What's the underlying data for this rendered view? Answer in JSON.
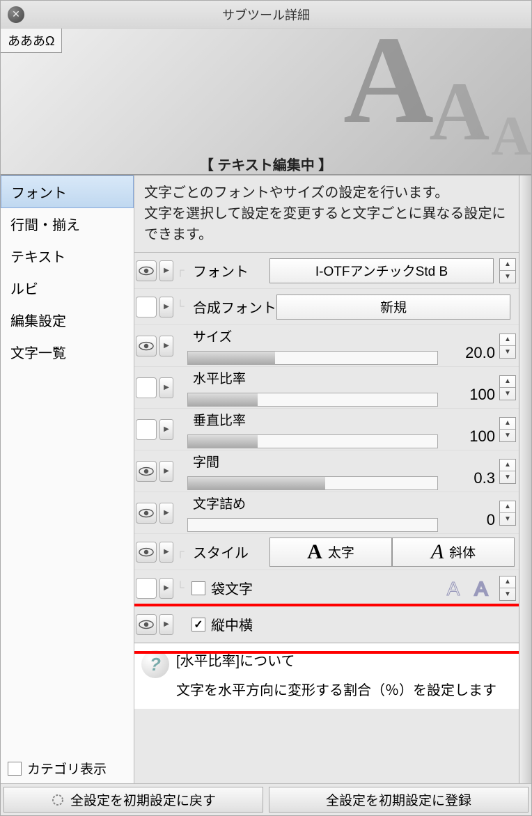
{
  "title": "サブツール詳細",
  "preview_tab": "あああΩ",
  "editing_text": "【 テキスト編集中 】",
  "sidebar": {
    "items": [
      {
        "label": "フォント"
      },
      {
        "label": "行間・揃え"
      },
      {
        "label": "テキスト"
      },
      {
        "label": "ルビ"
      },
      {
        "label": "編集設定"
      },
      {
        "label": "文字一覧"
      }
    ],
    "category_label": "カテゴリ表示"
  },
  "description": "文字ごとのフォントやサイズの設定を行います。\n文字を選択して設定を変更すると文字ごとに異なる設定にできます。",
  "font": {
    "label": "フォント",
    "value": "I-OTFアンチックStd B"
  },
  "composite_font": {
    "label": "合成フォント",
    "button": "新規"
  },
  "size": {
    "label": "サイズ",
    "value": "20.0",
    "fill": 35
  },
  "h_ratio": {
    "label": "水平比率",
    "value": "100",
    "fill": 28
  },
  "v_ratio": {
    "label": "垂直比率",
    "value": "100",
    "fill": 28
  },
  "spacing": {
    "label": "字間",
    "value": "0.3",
    "fill": 55
  },
  "tsume": {
    "label": "文字詰め",
    "value": "0",
    "fill": 0
  },
  "style": {
    "label": "スタイル",
    "bold": "太字",
    "italic": "斜体"
  },
  "outline": {
    "label": "袋文字"
  },
  "tatechuyoko": {
    "label": "縦中横",
    "checked": true
  },
  "help": {
    "title": "[水平比率]について",
    "body": "文字を水平方向に変形する割合（％）を設定します"
  },
  "footer": {
    "reset": "全設定を初期設定に戻す",
    "register": "全設定を初期設定に登録"
  }
}
